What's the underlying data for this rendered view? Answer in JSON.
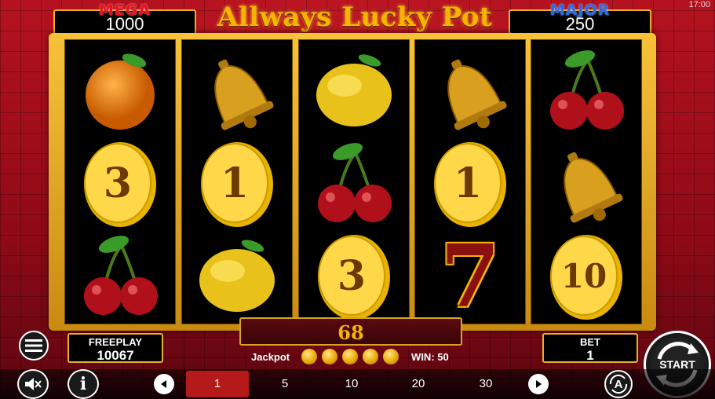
{
  "status_bar": {
    "time": "17:00"
  },
  "game": {
    "title": "Allways Lucky Pot"
  },
  "jackpots": {
    "mega": {
      "label": "MEGA",
      "value": "1000",
      "color": "#e8121f"
    },
    "major": {
      "label": "MAJOR",
      "value": "250",
      "color": "#2a6be8"
    }
  },
  "reels": [
    {
      "symbols": [
        {
          "type": "orange"
        },
        {
          "type": "coin",
          "value": "3"
        },
        {
          "type": "cherry"
        }
      ]
    },
    {
      "symbols": [
        {
          "type": "bell"
        },
        {
          "type": "coin",
          "value": "1"
        },
        {
          "type": "lemon"
        }
      ]
    },
    {
      "symbols": [
        {
          "type": "lemon"
        },
        {
          "type": "cherry"
        },
        {
          "type": "coin",
          "value": "3"
        }
      ]
    },
    {
      "symbols": [
        {
          "type": "bell"
        },
        {
          "type": "coin",
          "value": "1"
        },
        {
          "type": "seven",
          "value": "7"
        }
      ]
    },
    {
      "symbols": [
        {
          "type": "cherry"
        },
        {
          "type": "bell"
        },
        {
          "type": "coin",
          "value": "10"
        }
      ]
    }
  ],
  "win_display": {
    "value": "68"
  },
  "freeplay": {
    "label": "FREEPLAY",
    "value": "10067"
  },
  "bet": {
    "label": "BET",
    "value": "1"
  },
  "jackpot_row": {
    "label": "Jackpot",
    "coins": 5,
    "win_label": "WIN: 50"
  },
  "bet_options": {
    "values": [
      "1",
      "5",
      "10",
      "20",
      "30"
    ],
    "selected": "1"
  },
  "controls": {
    "start_label": "START",
    "auto_label": "A"
  },
  "colors": {
    "gold": "#f5b400",
    "frame": "#e8b02a",
    "background": "#8a0a14"
  }
}
